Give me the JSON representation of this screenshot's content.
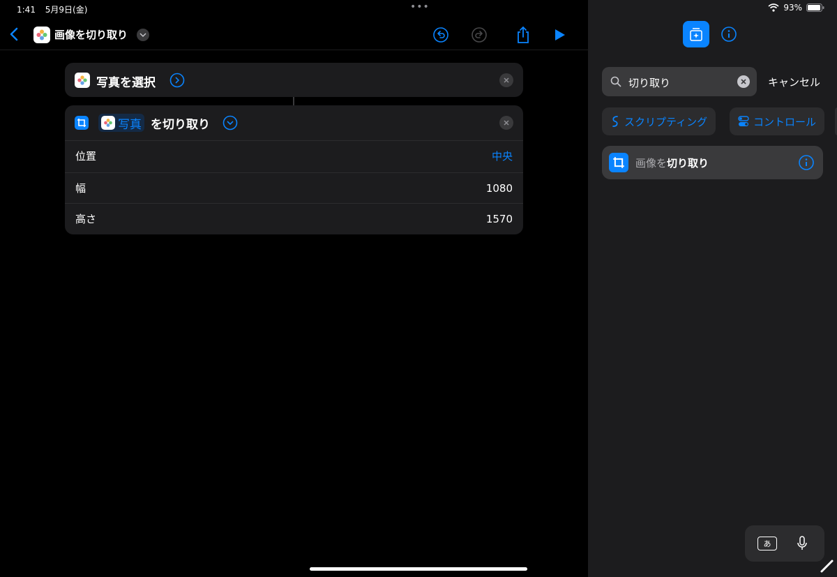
{
  "status": {
    "time": "1:41",
    "date": "5月9日(金)",
    "battery": "93%"
  },
  "nav": {
    "title": "画像を切り取り"
  },
  "actions": {
    "select": {
      "label": "写真を選択"
    },
    "crop": {
      "token": "写真",
      "suffix": "を切り取り",
      "rows": [
        {
          "label": "位置",
          "value": "中央"
        },
        {
          "label": "幅",
          "value": "1080"
        },
        {
          "label": "高さ",
          "value": "1570"
        }
      ]
    }
  },
  "sidebar": {
    "search": {
      "value": "切り取り",
      "cancel": "キャンセル"
    },
    "chips": [
      {
        "label": "スクリプティング"
      },
      {
        "label": "コントロール"
      }
    ],
    "result": {
      "prefix": "画像を",
      "match": "切り取り"
    }
  },
  "keyboard": {
    "key_label": "あ"
  },
  "colors": {
    "accent": "#0a84ff",
    "card": "#1c1c1e",
    "sidebar": "#1c1c1e"
  }
}
